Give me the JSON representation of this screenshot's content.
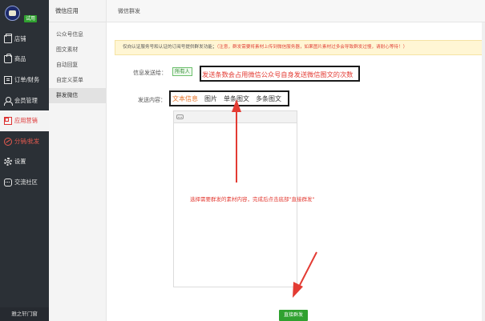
{
  "brand": {
    "trial_badge": "试用"
  },
  "sidebar": {
    "items": [
      {
        "label": "店铺",
        "icon": "store-icon"
      },
      {
        "label": "商品",
        "icon": "bag-icon"
      },
      {
        "label": "订单/财务",
        "icon": "order-icon"
      },
      {
        "label": "会员管理",
        "icon": "user-icon"
      },
      {
        "label": "应用营销",
        "icon": "grid-icon"
      },
      {
        "label": "分销/批发",
        "icon": "share-icon"
      },
      {
        "label": "设置",
        "icon": "gear-icon"
      },
      {
        "label": "交流社区",
        "icon": "chat-icon"
      }
    ],
    "footer": "雅之轩门窗"
  },
  "submenu": {
    "title": "微信应用",
    "items": [
      "公众号信息",
      "图文素材",
      "自动回复",
      "自定义菜单",
      "群发微信"
    ]
  },
  "header": {
    "title": "微信群发"
  },
  "notice": {
    "text": "仅向认证服务号和认证的订阅号提供群发功能；",
    "warning": "（注意，群发需要将素材上传到微信服务器，如果图片素材过多会导致群发过慢，请耐心等待！）"
  },
  "form": {
    "recipient_label": "信息发送给：",
    "recipient_value": "所有人",
    "recipient_note": "发送条数会占用微信公众号自身发送微信图文的次数",
    "content_label": "发送内容：",
    "tabs": [
      "文本信息",
      "图片",
      "单条图文",
      "多条图文"
    ],
    "guide_text": "选择需要群发的素材内容，完成后点击底部\"直接群发\"",
    "send_label": "直接群发"
  },
  "colors": {
    "accent_green": "#2fa12f",
    "warning_red": "#e33b33",
    "active_tab": "#e8762b",
    "sidebar_bg": "#2b3036"
  }
}
